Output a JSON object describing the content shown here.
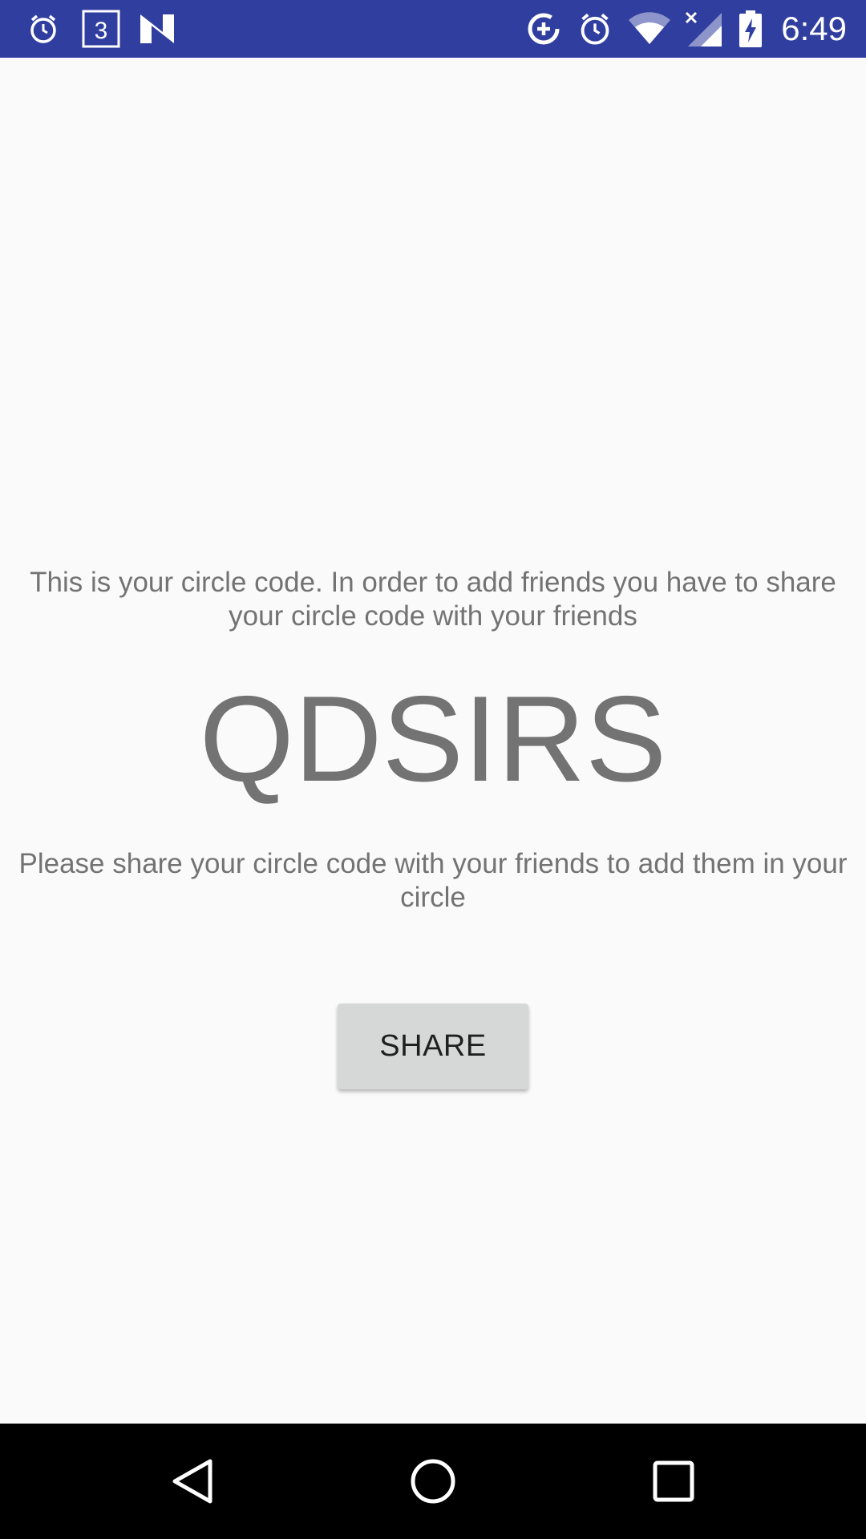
{
  "status_bar": {
    "time": "6:49",
    "left_icons": [
      "alarm-icon",
      "calendar-3-icon",
      "n-app-icon"
    ],
    "right_icons": [
      "data-saver-icon",
      "alarm-icon",
      "wifi-icon",
      "signal-no-data-icon",
      "battery-charging-icon"
    ],
    "background_color": "#303f9f"
  },
  "main": {
    "intro_text": "This is your circle code. In order to add friends you have to share your circle code with your friends",
    "circle_code": "QDSIRS",
    "share_instructions": "Please share your circle code with your friends to add them in your circle",
    "share_button_label": "SHARE"
  },
  "nav_bar": {
    "buttons": [
      "back",
      "home",
      "recents"
    ]
  }
}
